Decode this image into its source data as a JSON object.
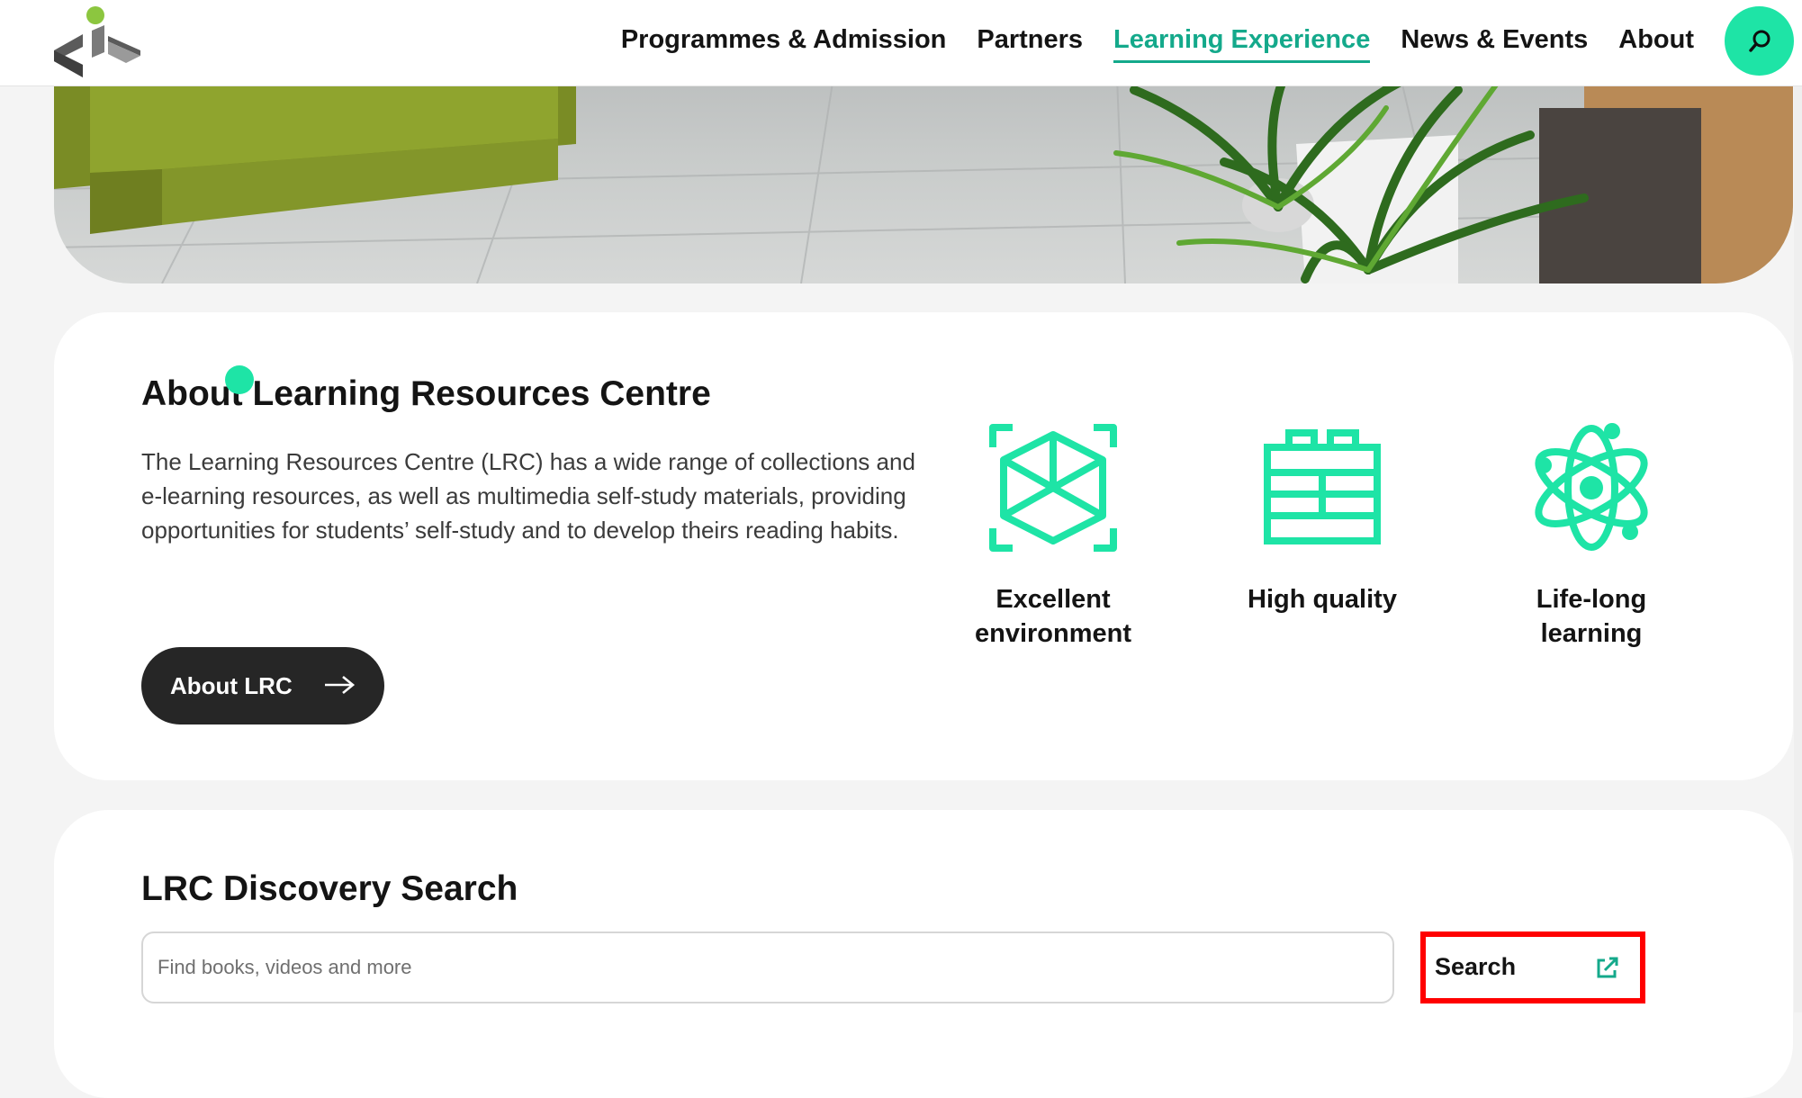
{
  "colors": {
    "accent": "#1ee4a6",
    "accent_text": "#14a98b",
    "dark_button": "#262626",
    "highlight_border": "#ff0000"
  },
  "header": {
    "logo_icon": "institution-logo",
    "nav": [
      {
        "label": "Programmes & Admission",
        "active": false
      },
      {
        "label": "Partners",
        "active": false
      },
      {
        "label": "Learning Experience",
        "active": true
      },
      {
        "label": "News & Events",
        "active": false
      },
      {
        "label": "About",
        "active": false
      }
    ],
    "search_icon": "search-icon"
  },
  "hero": {
    "image": "library-lobby-photo"
  },
  "about": {
    "title": "About Learning Resources Centre",
    "description": "The Learning Resources Centre (LRC) has a wide range of collections and e-learning resources, as well as multimedia self-study materials, providing opportunities for students’ self-study and to develop theirs reading habits.",
    "button_label": "About LRC",
    "button_icon": "arrow-right-icon",
    "features": [
      {
        "icon": "cube-scan-icon",
        "label": "Excellent environment"
      },
      {
        "icon": "bricks-icon",
        "label": "High quality"
      },
      {
        "icon": "atom-icon",
        "label": "Life-long learning"
      }
    ]
  },
  "discovery": {
    "title": "LRC Discovery Search",
    "input_value": "",
    "input_placeholder": "Find books, videos and more",
    "button_label": "Search",
    "button_icon": "external-link-icon"
  }
}
